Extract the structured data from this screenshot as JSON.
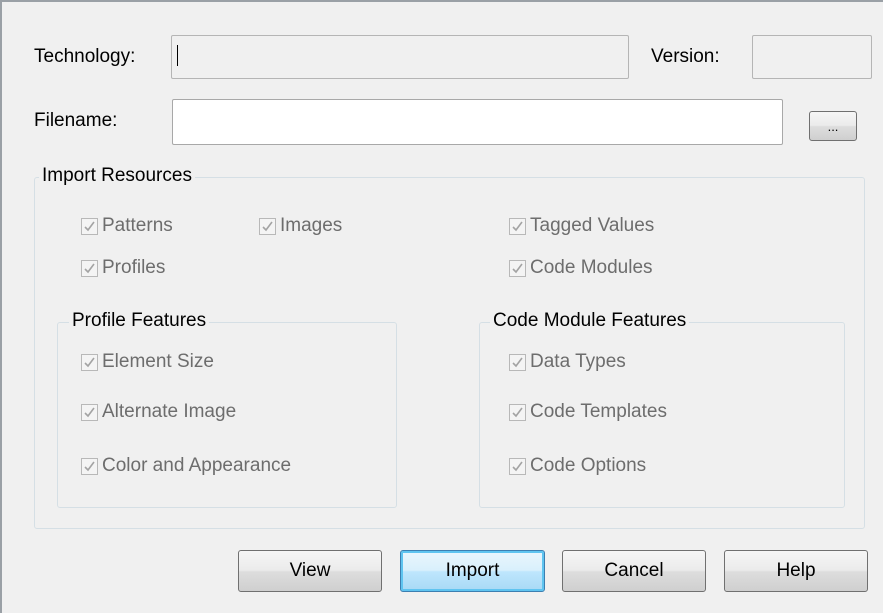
{
  "technology": {
    "label": "Technology:",
    "value": ""
  },
  "version": {
    "label": "Version:",
    "value": ""
  },
  "filename": {
    "label": "Filename:",
    "value": "",
    "browse_label": "..."
  },
  "import_resources": {
    "title": "Import Resources",
    "patterns": "Patterns",
    "images": "Images",
    "tagged_values": "Tagged Values",
    "profiles": "Profiles",
    "code_modules": "Code Modules"
  },
  "profile_features": {
    "title": "Profile Features",
    "element_size": "Element Size",
    "alternate_image": "Alternate Image",
    "color_and_appearance": "Color and Appearance"
  },
  "code_module_features": {
    "title": "Code Module Features",
    "data_types": "Data Types",
    "code_templates": "Code Templates",
    "code_options": "Code Options"
  },
  "buttons": {
    "view": "View",
    "import": "Import",
    "cancel": "Cancel",
    "help": "Help"
  },
  "colors": {
    "disabled_text": "#6d6d6d",
    "default_button_border": "#3c7fb1"
  }
}
